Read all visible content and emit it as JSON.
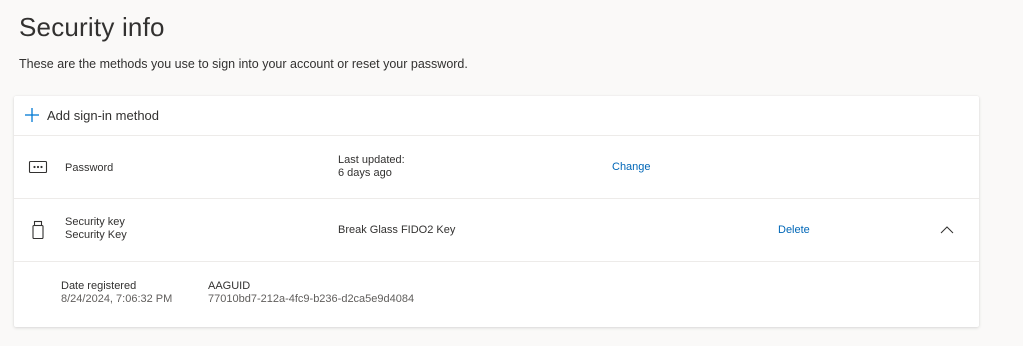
{
  "header": {
    "title": "Security info",
    "subtitle": "These are the methods you use to sign into your account or reset your password."
  },
  "add_method": {
    "label": "Add sign-in method",
    "icon": "plus-icon"
  },
  "methods": [
    {
      "icon": "password-dots-icon",
      "name": "Password",
      "detail_label": "Last updated:",
      "detail_value": "6 days ago",
      "action": "Change"
    },
    {
      "icon": "usb-security-key-icon",
      "name": "Security key",
      "subname": "Security Key",
      "detail": "Break Glass FIDO2 Key",
      "action": "Delete",
      "expanded": true,
      "expand_icon": "chevron-up-icon"
    }
  ],
  "security_key_details": {
    "date_label": "Date registered",
    "date_value": "8/24/2024, 7:06:32 PM",
    "aaguid_label": "AAGUID",
    "aaguid_value": "77010bd7-212a-4fc9-b236-d2ca5e9d4084"
  },
  "colors": {
    "link": "#0067b8",
    "background": "#faf9f8",
    "card": "#ffffff",
    "accent": "#0078d4"
  }
}
